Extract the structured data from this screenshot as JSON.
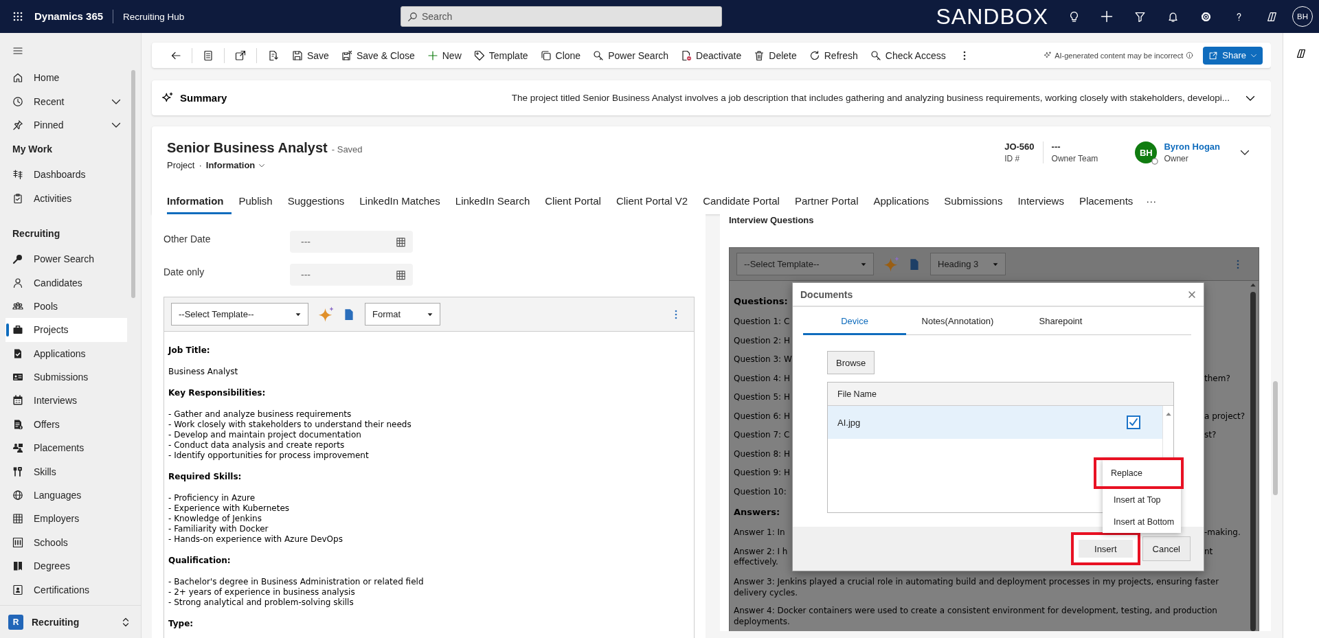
{
  "top_bar": {
    "app_name": "Dynamics 365",
    "area": "Recruiting Hub",
    "search": {
      "placeholder": "Search"
    },
    "environment": "SANDBOX",
    "user_initials": "BH"
  },
  "nav": {
    "sections": [
      {
        "items": [
          {
            "label": "Home",
            "selected": false
          },
          {
            "label": "Recent",
            "selected": false,
            "expanded": false
          },
          {
            "label": "Pinned",
            "selected": false,
            "expanded": false
          }
        ]
      },
      {
        "title": "My Work",
        "items": [
          {
            "label": "Dashboards",
            "selected": false
          },
          {
            "label": "Activities",
            "selected": false
          }
        ]
      },
      {
        "title": "Recruiting",
        "items": [
          {
            "label": "Power Search",
            "selected": false
          },
          {
            "label": "Candidates",
            "selected": false
          },
          {
            "label": "Pools",
            "selected": false
          },
          {
            "label": "Projects",
            "selected": true
          },
          {
            "label": "Applications",
            "selected": false
          },
          {
            "label": "Submissions",
            "selected": false
          },
          {
            "label": "Interviews",
            "selected": false
          },
          {
            "label": "Offers",
            "selected": false
          },
          {
            "label": "Placements",
            "selected": false
          },
          {
            "label": "Skills",
            "selected": false
          },
          {
            "label": "Languages",
            "selected": false
          },
          {
            "label": "Employers",
            "selected": false
          },
          {
            "label": "Schools",
            "selected": false
          },
          {
            "label": "Degrees",
            "selected": false
          },
          {
            "label": "Certifications",
            "selected": false
          }
        ]
      }
    ],
    "area": {
      "initial": "R",
      "label": "Recruiting"
    }
  },
  "command_bar": {
    "buttons": [
      "Save",
      "Save & Close",
      "New",
      "Template",
      "Clone",
      "Power Search",
      "Deactivate",
      "Delete",
      "Refresh",
      "Check Access"
    ],
    "notice": "AI-generated content may be incorrect",
    "share": "Share"
  },
  "summary": {
    "title": "Summary",
    "text": "The project titled Senior Business Analyst involves a job description that includes gathering and analyzing business requirements, working closely with stakeholders, developi..."
  },
  "record": {
    "title": "Senior Business Analyst",
    "status": "- Saved",
    "entity": "Project",
    "separator": "·",
    "form": "Information",
    "fields": [
      {
        "value": "JO-560",
        "label": "ID #"
      },
      {
        "value": "---",
        "label": "Owner Team"
      }
    ],
    "owner": {
      "initials": "BH",
      "name": "Byron Hogan",
      "label": "Owner"
    },
    "tabs": [
      {
        "label": "Information",
        "selected": true
      },
      {
        "label": "Publish",
        "selected": false
      },
      {
        "label": "Suggestions",
        "selected": false
      },
      {
        "label": "LinkedIn Matches",
        "selected": false
      },
      {
        "label": "LinkedIn Search",
        "selected": false
      },
      {
        "label": "Client Portal",
        "selected": false
      },
      {
        "label": "Client Portal V2",
        "selected": false
      },
      {
        "label": "Candidate Portal",
        "selected": false
      },
      {
        "label": "Partner Portal",
        "selected": false
      },
      {
        "label": "Applications",
        "selected": false
      },
      {
        "label": "Submissions",
        "selected": false
      },
      {
        "label": "Interviews",
        "selected": false
      },
      {
        "label": "Placements",
        "selected": false
      }
    ],
    "more": "···"
  },
  "left_panel": {
    "fields": [
      {
        "label": "Other Date",
        "value": "---"
      },
      {
        "label": "Date only",
        "value": "---"
      }
    ],
    "editor": {
      "template": "--Select Template--",
      "format": "Format",
      "content": [
        {
          "kind": "heading",
          "text": "Job Title:"
        },
        {
          "kind": "paragraph",
          "text": "Business Analyst"
        },
        {
          "kind": "heading",
          "text": "Key Responsibilities:"
        },
        {
          "kind": "list",
          "lines": [
            "- Gather and analyze business requirements",
            "- Work closely with stakeholders to understand their needs",
            "- Develop and maintain project documentation",
            "- Conduct data analysis and create reports",
            "- Identify opportunities for process improvement"
          ]
        },
        {
          "kind": "heading",
          "text": "Required Skills:"
        },
        {
          "kind": "list",
          "lines": [
            "- Proficiency in Azure",
            "- Experience with Kubernetes",
            "- Knowledge of Jenkins",
            "- Familiarity with Docker",
            "- Hands-on experience with Azure DevOps"
          ]
        },
        {
          "kind": "heading",
          "text": "Qualification:"
        },
        {
          "kind": "list",
          "lines": [
            "- Bachelor's degree in Business Administration or related field",
            "- 2+ years of experience in business analysis",
            "- Strong analytical and problem-solving skills"
          ]
        },
        {
          "kind": "heading",
          "text": "Type:"
        }
      ]
    }
  },
  "right_panel": {
    "title": "Interview Questions",
    "editor": {
      "template": "--Select Template--",
      "format": "Heading 3",
      "content": [
        {
          "kind": "heading",
          "text": "Questions:"
        },
        {
          "kind": "split",
          "left": [
            "Question 1: C"
          ]
        },
        {
          "kind": "split",
          "left": [
            "Question 2: H"
          ]
        },
        {
          "kind": "split",
          "left": [
            "Question 3: W"
          ]
        },
        {
          "kind": "split",
          "left": [
            "Question 4: H"
          ],
          "right": [
            "them?"
          ]
        },
        {
          "kind": "split",
          "left": [
            "Question 5: H"
          ]
        },
        {
          "kind": "split",
          "left": [
            "Question 6: H"
          ],
          "right": [
            "a project?"
          ]
        },
        {
          "kind": "split",
          "left": [
            "Question 7: C"
          ],
          "right": [
            "st?"
          ]
        },
        {
          "kind": "split",
          "left": [
            "Question 8: H"
          ]
        },
        {
          "kind": "split",
          "left": [
            "Question 9: H"
          ]
        },
        {
          "kind": "split",
          "left": [
            "Question 10:"
          ]
        },
        {
          "kind": "heading",
          "text": "Answers:"
        },
        {
          "kind": "split",
          "left": [
            "Answer 1: In"
          ],
          "right": [
            "-making."
          ]
        },
        {
          "kind": "split",
          "left": [
            "Answer 2: I h",
            "effectively."
          ],
          "right": [
            "nt"
          ]
        },
        {
          "kind": "paragraph",
          "text": "Answer 3: Jenkins played a crucial role in automating build and deployment processes in my projects, ensuring faster delivery cycles."
        },
        {
          "kind": "paragraph",
          "text": "Answer 4: Docker containers were used to create a consistent environment for development, testing, and production deployments."
        }
      ]
    },
    "dialog": {
      "title": "Documents",
      "tabs": [
        {
          "label": "Device",
          "selected": true
        },
        {
          "label": "Notes(Annotation)",
          "selected": false
        },
        {
          "label": "Sharepoint",
          "selected": false
        }
      ],
      "browse": "Browse",
      "table": {
        "columns": [
          "File Name"
        ],
        "rows": [
          {
            "name": "AI.jpg",
            "selected": true,
            "checked": true
          }
        ]
      },
      "menu": [
        {
          "label": "Replace",
          "highlighted": true
        },
        {
          "label": "Insert at Top",
          "highlighted": false
        },
        {
          "label": "Insert at Bottom",
          "highlighted": false
        }
      ],
      "buttons": [
        {
          "label": "Insert",
          "highlighted": true
        },
        {
          "label": "Cancel",
          "highlighted": false
        }
      ]
    }
  }
}
